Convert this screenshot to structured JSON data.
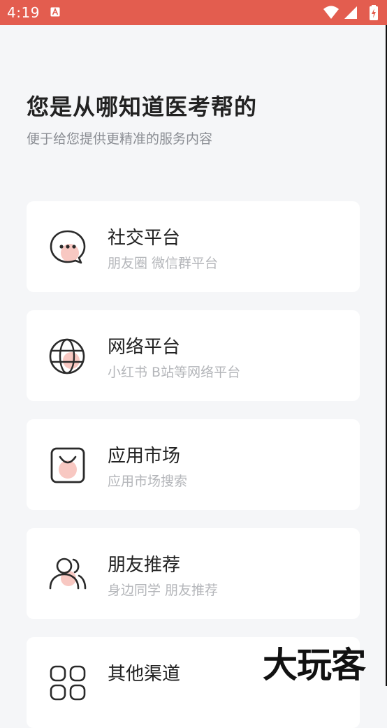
{
  "status_bar": {
    "time": "4:19",
    "notification_icon": "app-a-icon",
    "wifi_icon": "wifi-icon",
    "signal_icon": "signal-icon",
    "battery_icon": "battery-charging-icon"
  },
  "header": {
    "title": "您是从哪知道医考帮的",
    "subtitle": "便于给您提供更精准的服务内容"
  },
  "options": [
    {
      "icon": "chat-bubble-icon",
      "title": "社交平台",
      "desc": "朋友圈 微信群平台"
    },
    {
      "icon": "globe-icon",
      "title": "网络平台",
      "desc": "小红书 B站等网络平台"
    },
    {
      "icon": "shopping-bag-icon",
      "title": "应用市场",
      "desc": "应用市场搜索"
    },
    {
      "icon": "users-icon",
      "title": "朋友推荐",
      "desc": "身边同学 朋友推荐"
    },
    {
      "icon": "apps-grid-icon",
      "title": "其他渠道",
      "desc": ""
    }
  ],
  "watermark": "大玩客",
  "colors": {
    "status_bar": "#e35d4f",
    "background": "#f5f6f8",
    "icon_accent": "#f6b5ae"
  }
}
